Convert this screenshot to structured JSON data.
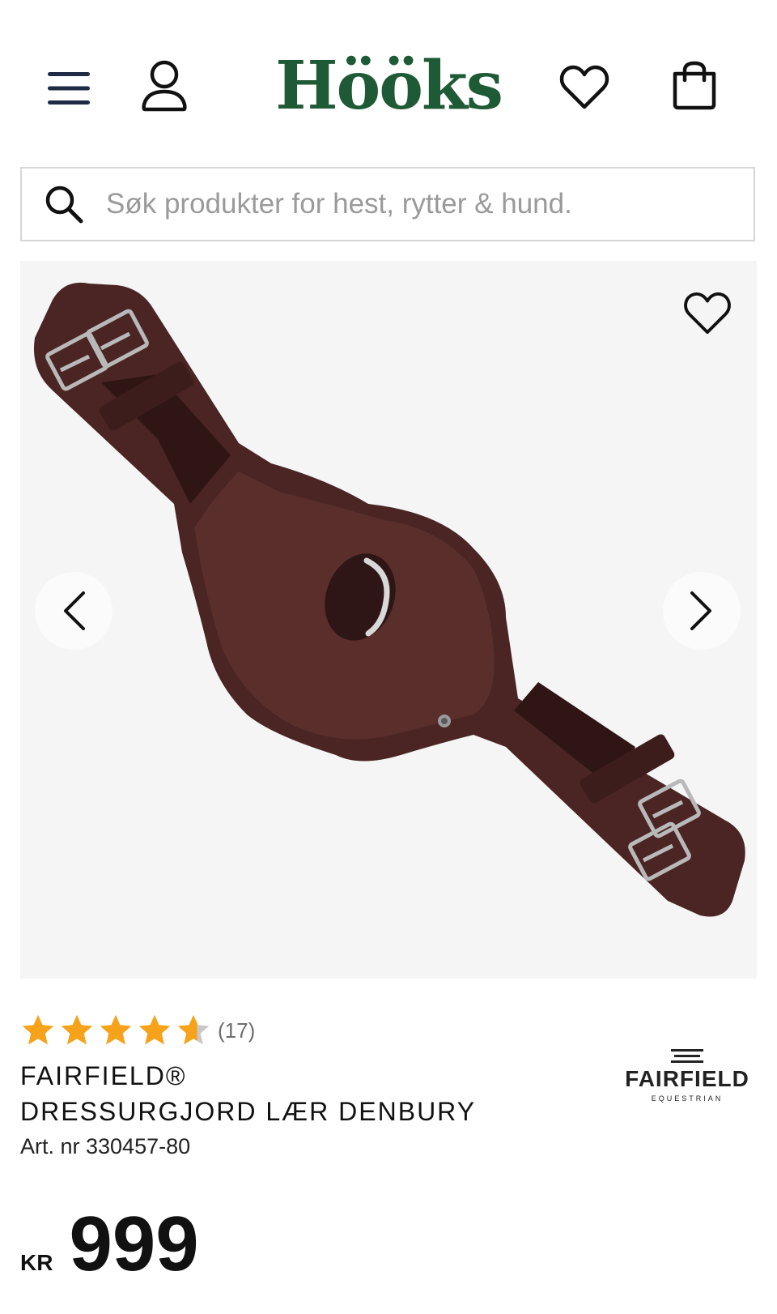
{
  "header": {
    "logo": "Hööks",
    "icons": [
      "menu-icon",
      "user-icon",
      "heart-icon",
      "shopping-bag-icon"
    ]
  },
  "search": {
    "placeholder": "Søk produkter for hest, rytter & hund."
  },
  "product": {
    "rating_value": 4.5,
    "rating_max": 5,
    "review_count": "(17)",
    "brand": "FAIRFIELD®",
    "name": "DRESSURGJORD LÆR DENBURY",
    "article_number": "Art. nr 330457-80",
    "brand_logo": {
      "name": "FAIRFIELD",
      "subtitle": "EQUESTRIAN"
    },
    "price": {
      "currency": "KR",
      "amount": "999"
    }
  },
  "colors": {
    "brand_green": "#1f5a36",
    "star_orange": "#f6a21a",
    "star_empty": "#c8c8c8",
    "leather_brown": "#4a2523",
    "gallery_bg": "#f5f5f5"
  }
}
